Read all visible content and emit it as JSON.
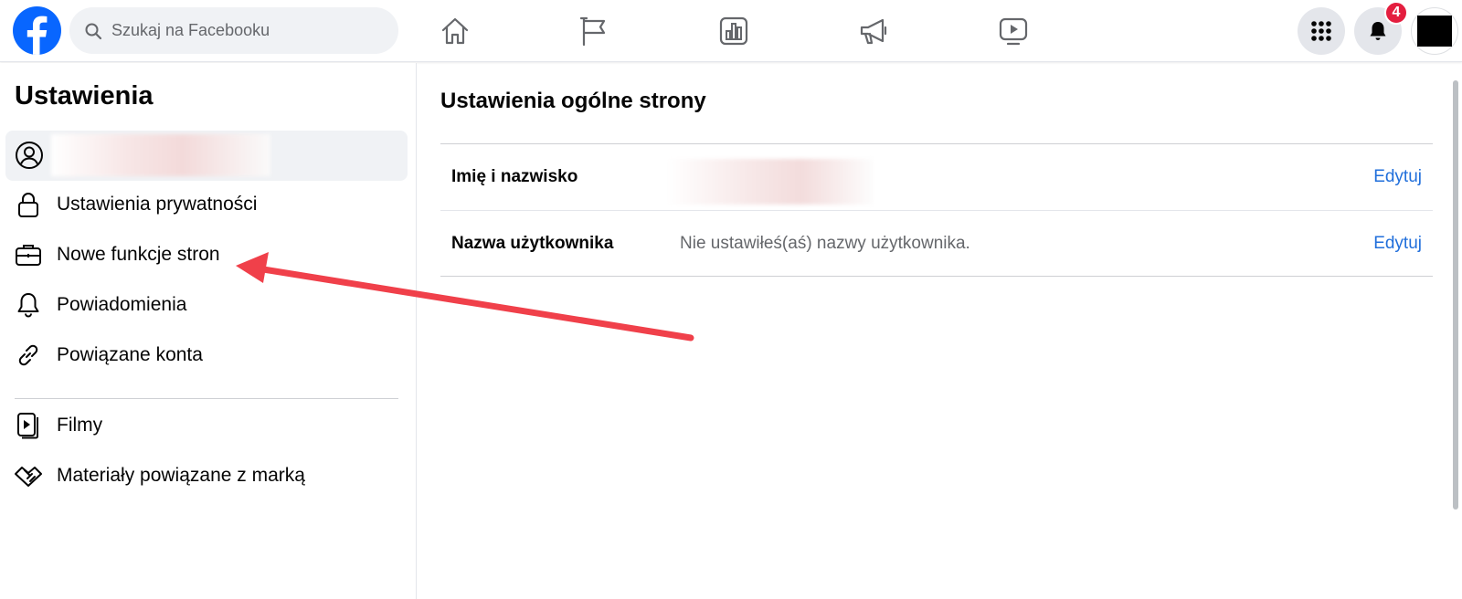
{
  "header": {
    "search_placeholder": "Szukaj na Facebooku",
    "notification_count": "4",
    "accent_color": "#0866ff"
  },
  "sidebar": {
    "title": "Ustawienia",
    "items": [
      {
        "label": "Ustawienia prywatności",
        "icon": "lock-icon"
      },
      {
        "label": "Nowe funkcje stron",
        "icon": "briefcase-icon"
      },
      {
        "label": "Powiadomienia",
        "icon": "bell-icon"
      },
      {
        "label": "Powiązane konta",
        "icon": "link-icon"
      },
      {
        "label": "Filmy",
        "icon": "video-icon"
      },
      {
        "label": "Materiały powiązane z marką",
        "icon": "handshake-icon"
      }
    ]
  },
  "main": {
    "title": "Ustawienia ogólne strony",
    "rows": [
      {
        "label": "Imię i nazwisko",
        "value": "",
        "action": "Edytuj"
      },
      {
        "label": "Nazwa użytkownika",
        "value": "Nie ustawiłeś(aś) nazwy użytkownika.",
        "action": "Edytuj"
      }
    ]
  }
}
